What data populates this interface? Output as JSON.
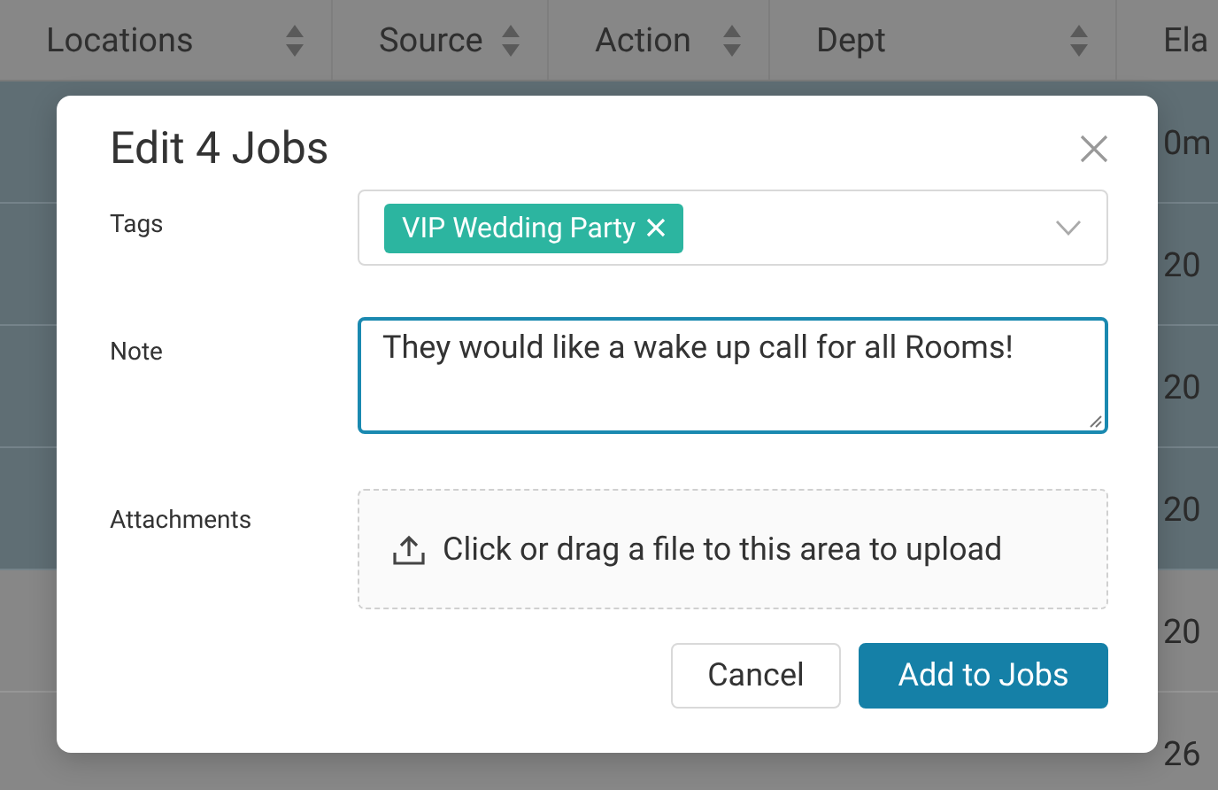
{
  "table": {
    "columns": [
      {
        "label": "Locations",
        "sortable": true
      },
      {
        "label": "Source",
        "sortable": true
      },
      {
        "label": "Action",
        "sortable": true
      },
      {
        "label": "Dept",
        "sortable": true
      },
      {
        "label": "Ela",
        "sortable": false
      }
    ],
    "rows": [
      {
        "selected": true,
        "elapsed": "0m"
      },
      {
        "selected": true,
        "elapsed": "20"
      },
      {
        "selected": true,
        "elapsed": "20"
      },
      {
        "selected": true,
        "elapsed": "20"
      },
      {
        "selected": false,
        "elapsed": "20"
      },
      {
        "selected": false,
        "elapsed": "26"
      }
    ]
  },
  "dialog": {
    "title": "Edit 4 Jobs",
    "fields": [
      {
        "kind": "tags",
        "label": "Tags",
        "tags": [
          "VIP Wedding Party"
        ]
      },
      {
        "kind": "textarea",
        "label": "Note",
        "value": "They would like a wake up call for all Rooms!",
        "focused": true
      },
      {
        "kind": "upload",
        "label": "Attachments",
        "hint": "Click or drag a file to this area to upload"
      }
    ],
    "buttons": [
      {
        "label": "Cancel",
        "primary": false
      },
      {
        "label": "Add to Jobs",
        "primary": true
      }
    ]
  }
}
